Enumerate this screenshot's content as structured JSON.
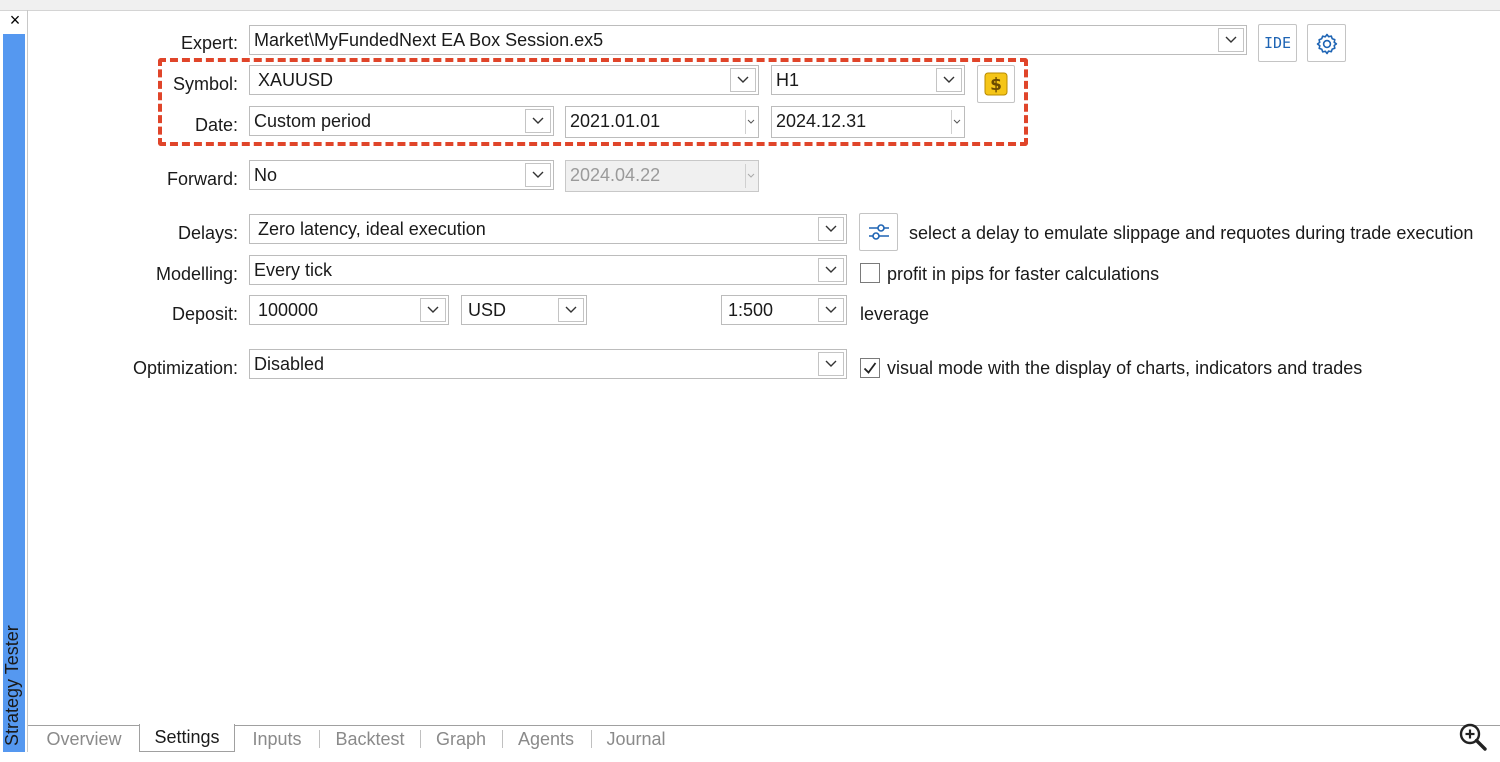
{
  "window": {
    "close_glyph": "×",
    "side_title": "Strategy Tester"
  },
  "expert": {
    "label": "Expert:",
    "value": "Market\\MyFundedNext EA Box Session.ex5",
    "ide_label": "IDE",
    "settings_icon": "gear-icon"
  },
  "symbol": {
    "label": "Symbol:",
    "value": "XAUUSD",
    "timeframe": "H1",
    "specs_icon": "dollar-icon"
  },
  "date": {
    "label": "Date:",
    "mode": "Custom period",
    "from": "2021.01.01",
    "to": "2024.12.31"
  },
  "forward": {
    "label": "Forward:",
    "value": "No",
    "date": "2024.04.22"
  },
  "delays": {
    "label": "Delays:",
    "value": "Zero latency, ideal execution",
    "hint": "select a delay to emulate slippage and requotes during trade execution"
  },
  "modelling": {
    "label": "Modelling:",
    "value": "Every tick",
    "checkbox_label": "profit in pips for faster calculations",
    "checked": false
  },
  "deposit": {
    "label": "Deposit:",
    "amount": "100000",
    "currency": "USD",
    "leverage": "1:500",
    "leverage_label": "leverage"
  },
  "optimization": {
    "label": "Optimization:",
    "value": "Disabled",
    "checkbox_label": "visual mode with the display of charts, indicators and trades",
    "checked": true
  },
  "tabs": [
    {
      "label": "Overview",
      "active": false
    },
    {
      "label": "Settings",
      "active": true
    },
    {
      "label": "Inputs",
      "active": false
    },
    {
      "label": "Backtest",
      "active": false
    },
    {
      "label": "Graph",
      "active": false
    },
    {
      "label": "Agents",
      "active": false
    },
    {
      "label": "Journal",
      "active": false
    }
  ],
  "colors": {
    "accent_blue": "#5598f0",
    "highlight_red": "#e0452a",
    "icon_blue": "#1e64b4",
    "dollar_gold": "#f5c518"
  }
}
